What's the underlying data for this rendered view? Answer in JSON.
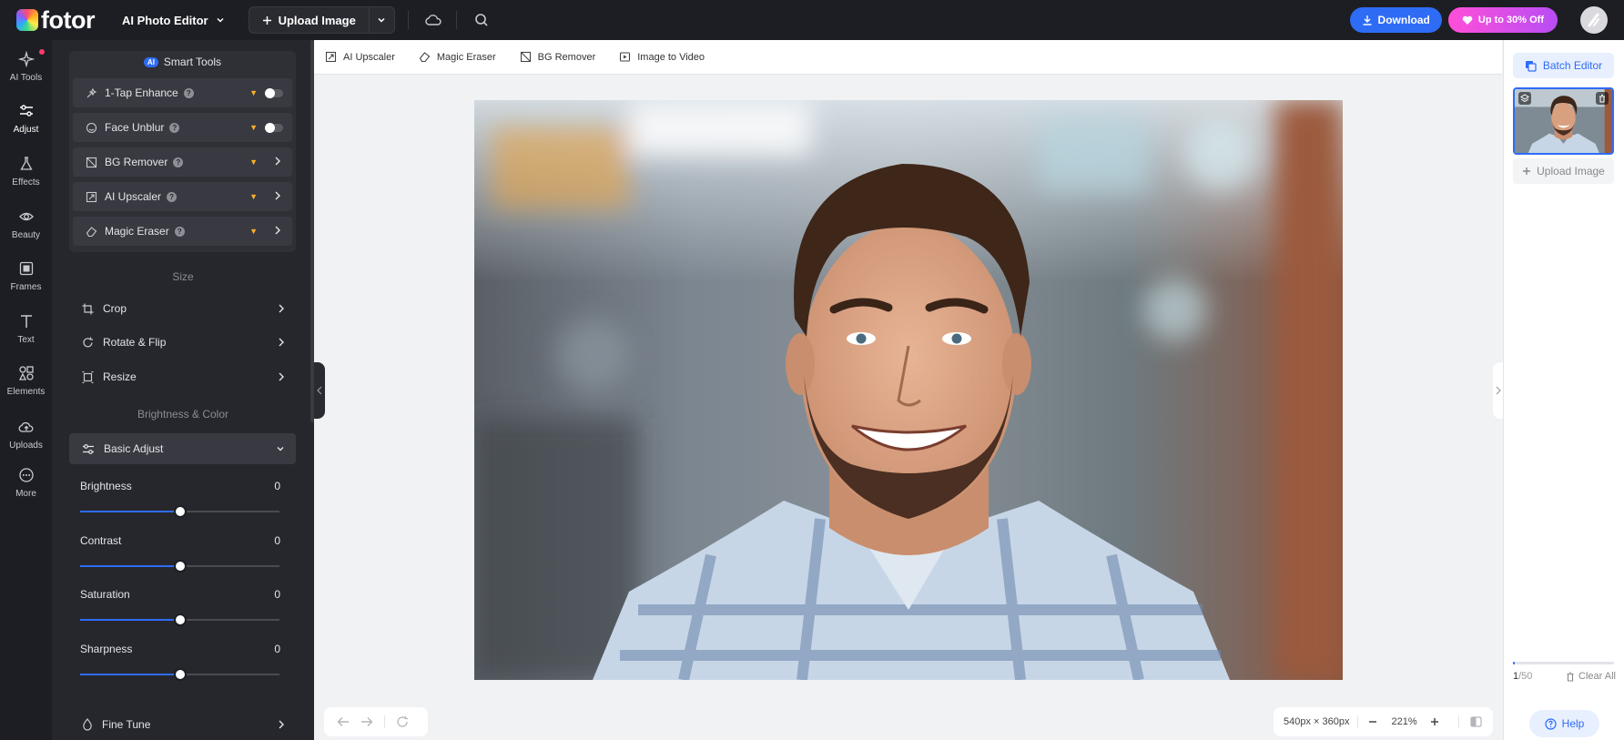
{
  "header": {
    "logo_text": "fotor",
    "app_title": "AI Photo Editor",
    "upload_label": "Upload Image",
    "download_label": "Download",
    "promo_label": "Up to 30% Off"
  },
  "rail": {
    "items": [
      {
        "label": "AI Tools",
        "icon": "sparkle-icon"
      },
      {
        "label": "Adjust",
        "icon": "sliders-icon"
      },
      {
        "label": "Effects",
        "icon": "flask-icon"
      },
      {
        "label": "Beauty",
        "icon": "eye-icon"
      },
      {
        "label": "Frames",
        "icon": "frame-icon"
      },
      {
        "label": "Text",
        "icon": "text-icon"
      },
      {
        "label": "Elements",
        "icon": "shapes-icon"
      },
      {
        "label": "Uploads",
        "icon": "cloud-upload-icon"
      },
      {
        "label": "More",
        "icon": "more-icon"
      }
    ]
  },
  "smart_tools": {
    "badge": "AI",
    "title": "Smart Tools",
    "items": [
      {
        "label": "1-Tap Enhance",
        "control": "toggle"
      },
      {
        "label": "Face Unblur",
        "control": "toggle"
      },
      {
        "label": "BG Remover",
        "control": "chevron"
      },
      {
        "label": "AI Upscaler",
        "control": "chevron"
      },
      {
        "label": "Magic Eraser",
        "control": "chevron"
      }
    ]
  },
  "size_section": {
    "title": "Size",
    "items": [
      {
        "label": "Crop"
      },
      {
        "label": "Rotate & Flip"
      },
      {
        "label": "Resize"
      }
    ]
  },
  "color_section": {
    "title": "Brightness & Color",
    "basic_adjust_label": "Basic Adjust",
    "sliders": [
      {
        "label": "Brightness",
        "value": "0",
        "level": 0.5
      },
      {
        "label": "Contrast",
        "value": "0",
        "level": 0.5
      },
      {
        "label": "Saturation",
        "value": "0",
        "level": 0.5
      },
      {
        "label": "Sharpness",
        "value": "0",
        "level": 0.5
      }
    ],
    "fine_tune_label": "Fine Tune"
  },
  "quickbar": {
    "items": [
      {
        "label": "AI Upscaler"
      },
      {
        "label": "Magic Eraser"
      },
      {
        "label": "BG Remover"
      },
      {
        "label": "Image to Video"
      }
    ]
  },
  "canvas": {
    "dimensions": "540px × 360px",
    "zoom": "221%"
  },
  "right_panel": {
    "batch_label": "Batch Editor",
    "upload_label": "Upload Image",
    "count_current": "1",
    "count_total": "/50",
    "count_fraction": 0.02,
    "clear_all_label": "Clear All",
    "help_label": "Help"
  },
  "colors": {
    "accent": "#2e6cf6",
    "dark_bg": "#1d1e23",
    "panel_bg": "#26272c",
    "promo_start": "#ff4fd8",
    "promo_end": "#b84df5"
  }
}
